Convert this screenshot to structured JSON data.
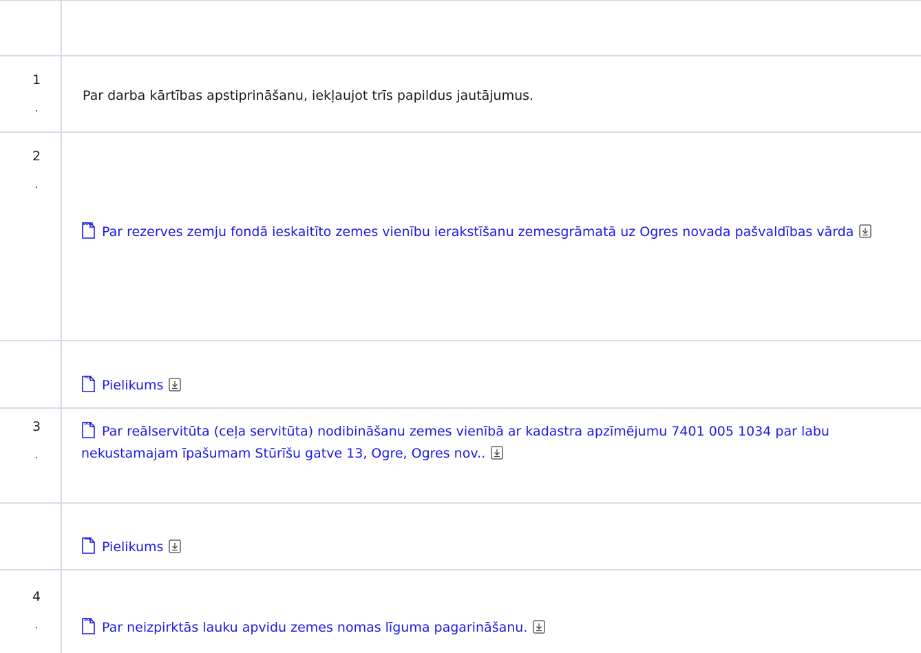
{
  "rows": [
    {
      "num": "",
      "dot": "",
      "text": ""
    },
    {
      "num": "1",
      "dot": ".",
      "text": "Par darba kārtības apstiprināšanu, iekļaujot trīs papildus jautājumus."
    },
    {
      "num": "2",
      "dot": ".",
      "file_type": "DOCX",
      "link": "Par rezerves zemju fondā ieskaitīto zemes vienību ierakstīšanu zemesgrāmatā uz Ogres novada pašvaldības vārda"
    },
    {
      "num": "",
      "dot": "",
      "file_type": "PDF",
      "link": "Pielikums"
    },
    {
      "num": "3",
      "dot": ".",
      "file_type": "DOC",
      "link": "Par reālservitūta (ceļa servitūta) nodibināšanu zemes vienībā ar kadastra apzīmējumu 7401 005 1034 par labu nekustamajam īpašumam Stūrīšu gatve 13, Ogre, Ogres nov.."
    },
    {
      "num": "",
      "dot": "",
      "file_type": "PDF",
      "link": "Pielikums"
    },
    {
      "num": "4",
      "dot": ".",
      "file_type": "DOC",
      "link": "Par neizpirktās lauku apvidu zemes nomas līguma pagarināšanu."
    }
  ],
  "colors": {
    "link": "#1a1ae6",
    "border": "#d6d9e6",
    "text": "#1a1a1a"
  },
  "icons": {
    "file": "file-document-icon",
    "download": "download-icon"
  }
}
